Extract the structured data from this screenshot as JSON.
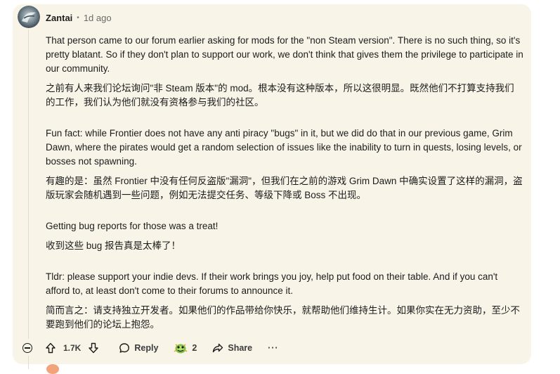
{
  "comment": {
    "author": "Zantai",
    "separator": "•",
    "age": "1d ago",
    "paragraphs": [
      "That person came to our forum earlier asking for mods for the \"non Steam version\". There is no such thing, so it's pretty blatant. So if they don't plan to support our work, we don't think that gives them the privilege to participate in our community.",
      "之前有人来我们论坛询问\"非 Steam 版本\"的 mod。根本没有这种版本，所以这很明显。既然他们不打算支持我们的工作，我们认为他们就没有资格参与我们的社区。",
      "Fun fact: while Frontier does not have any anti piracy \"bugs\" in it, but we did do that in our previous game, Grim Dawn, where the pirates would get a random selection of issues like the inability to turn in quests, losing levels, or bosses not spawning.",
      "有趣的是：虽然 Frontier 中没有任何反盗版\"漏洞\"，但我们在之前的游戏 Grim Dawn 中确实设置了这样的漏洞，盗版玩家会随机遇到一些问题，例如无法提交任务、等级下降或 Boss 不出现。",
      "Getting bug reports for those was a treat!",
      "收到这些 bug 报告真是太棒了！",
      "Tldr: please support your indie devs. If their work brings you joy, help put food on their table. And if you can't afford to, at least don't come to their forums to announce it.",
      "简而言之：请支持独立开发者。如果他们的作品带给你快乐，就帮助他们维持生计。如果你实在无力资助，至少不要跑到他们的论坛上抱怨。"
    ]
  },
  "actions": {
    "vote_count": "1.7K",
    "reply_label": "Reply",
    "award_count": "2",
    "share_label": "Share",
    "more_label": "···"
  },
  "colors": {
    "card_background": "#f8f4e8",
    "text": "#1c1c1c",
    "muted": "#6a6a6a"
  },
  "icons": [
    "collapse-icon",
    "upvote-icon",
    "downvote-icon",
    "reply-icon",
    "award-icon",
    "share-icon",
    "more-icon"
  ]
}
